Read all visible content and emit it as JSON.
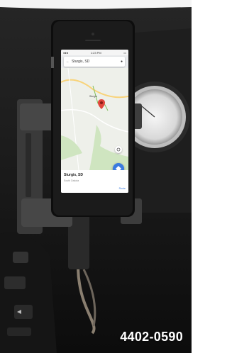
{
  "photo": {
    "part_number": "4402-0590"
  },
  "phone": {
    "status_time": "1:23 PM",
    "search_text": "Sturgis, SD",
    "map_label": "Sturgis",
    "place_name": "Sturgis, SD",
    "place_sub": "South Dakota",
    "action_label": "Route"
  },
  "colors": {
    "map_blue": "#3a7be0",
    "pin_red": "#e0463b",
    "route_green": "#7fbf5a"
  }
}
